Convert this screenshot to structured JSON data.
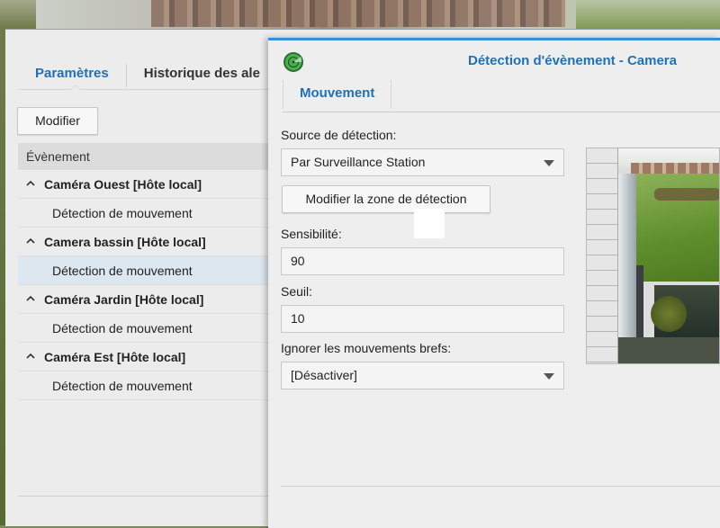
{
  "main": {
    "tabs": [
      {
        "label": "Paramètres",
        "active": true
      },
      {
        "label": "Historique des ale"
      }
    ],
    "modify_button": "Modifier",
    "list_header": "Évènement",
    "groups": [
      {
        "label": "Caméra Ouest [Hôte local]",
        "child": "Détection de mouvement"
      },
      {
        "label": "Camera bassin [Hôte local]",
        "child": "Détection de mouvement"
      },
      {
        "label": "Caméra Jardin [Hôte local]",
        "child": "Détection de mouvement"
      },
      {
        "label": "Caméra Est [Hôte local]",
        "child": "Détection de mouvement"
      }
    ],
    "selected_row": "Camera bassin [Hôte local] / Détection de mouvement"
  },
  "dialog": {
    "title": "Détection d'évènement - Camera",
    "tab": "Mouvement",
    "source_label": "Source de détection:",
    "source_value": "Par Surveillance Station",
    "zone_button": "Modifier la zone de détection",
    "sensitivity_label": "Sensibilité:",
    "sensitivity_value": "90",
    "threshold_label": "Seuil:",
    "threshold_value": "10",
    "ignore_label": "Ignorer les mouvements brefs:",
    "ignore_value": "[Désactiver]"
  },
  "colors": {
    "accent": "#1f71b7",
    "selected_row": "#dde7ef",
    "title_bar": "#3a8ddb"
  },
  "icons": {
    "app_icon": "surveillance-radar-icon",
    "expand": "chevron-up-icon",
    "dropdown": "caret-down-icon"
  }
}
